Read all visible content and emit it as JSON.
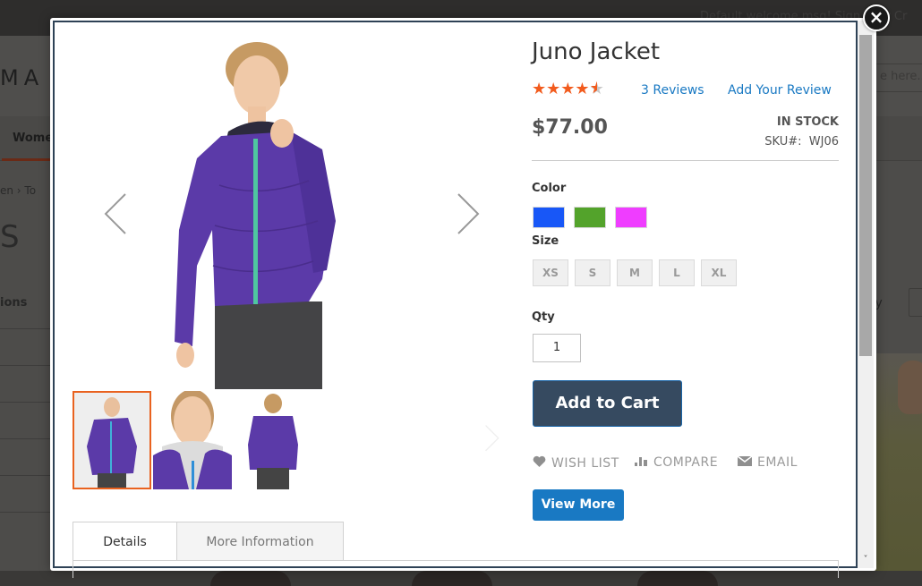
{
  "background_page": {
    "welcome_text": "Default welcome msg!  Sign In  or  Cr",
    "logo_fragment": "MA",
    "search_placeholder": "e here...",
    "nav_item": "Wome",
    "breadcrumb": "en  ›  To",
    "page_title_fragment": "S",
    "filter_heading_fragment": "ions",
    "sort_label_fragment": "t By"
  },
  "modal": {
    "close_label": "×",
    "scroll_up_label": "˄",
    "scroll_down_label": "˅"
  },
  "gallery": {
    "prev_label": "previous",
    "next_label": "next",
    "thumbnails": [
      {
        "alt": "Juno Jacket front",
        "active": true
      },
      {
        "alt": "Juno Jacket closeup",
        "active": false
      },
      {
        "alt": "Juno Jacket back",
        "active": false
      }
    ]
  },
  "product": {
    "name": "Juno Jacket",
    "rating": {
      "value": 4.5,
      "max": 5,
      "stars": [
        "★",
        "★",
        "★",
        "★",
        "★"
      ]
    },
    "reviews_link": "3 Reviews",
    "add_review_link": "Add Your Review",
    "price": "$77.00",
    "stock_status": "IN STOCK",
    "sku_label": "SKU#:",
    "sku_value": "WJ06",
    "color_label": "Color",
    "colors": [
      {
        "name": "Blue",
        "hex": "#1857f7"
      },
      {
        "name": "Green",
        "hex": "#53a32b"
      },
      {
        "name": "Purple",
        "hex": "#ef3dff"
      }
    ],
    "size_label": "Size",
    "sizes": [
      "XS",
      "S",
      "M",
      "L",
      "XL"
    ],
    "qty_label": "Qty",
    "qty_value": "1",
    "add_to_cart": "Add to Cart",
    "actions": {
      "wishlist": "WISH LIST",
      "compare": "COMPARE",
      "email": "EMAIL"
    },
    "view_more": "View More"
  },
  "tabs": [
    {
      "label": "Details",
      "active": true
    },
    {
      "label": "More Information",
      "active": false
    }
  ],
  "colors": {
    "accent_orange": "#f25b1d",
    "link_blue": "#1979c3",
    "cart_button": "#364a60",
    "thumb_active_border": "#e9621f"
  }
}
